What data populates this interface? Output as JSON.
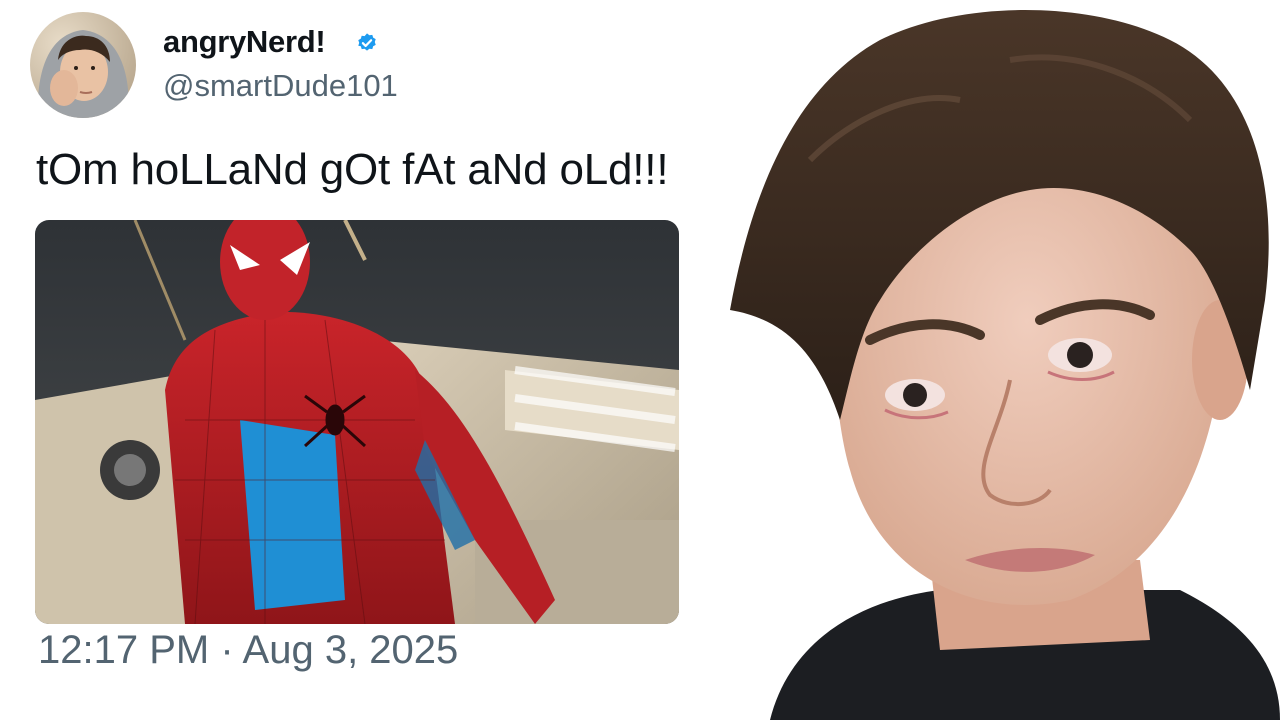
{
  "tweet": {
    "author": {
      "display_name": "angryNerd!",
      "handle": "@smartDude101",
      "verified": true
    },
    "text": "tOm hoLLaNd gOt fAt aNd oLd!!!",
    "timestamp": "12:17 PM · Aug 3, 2025",
    "media": {
      "type": "photo"
    }
  },
  "icons": {
    "verified": "verified-badge-icon"
  },
  "colors": {
    "name": "#0f1419",
    "secondary": "#536471",
    "verified": "#1d9bf0",
    "background": "#ffffff"
  }
}
